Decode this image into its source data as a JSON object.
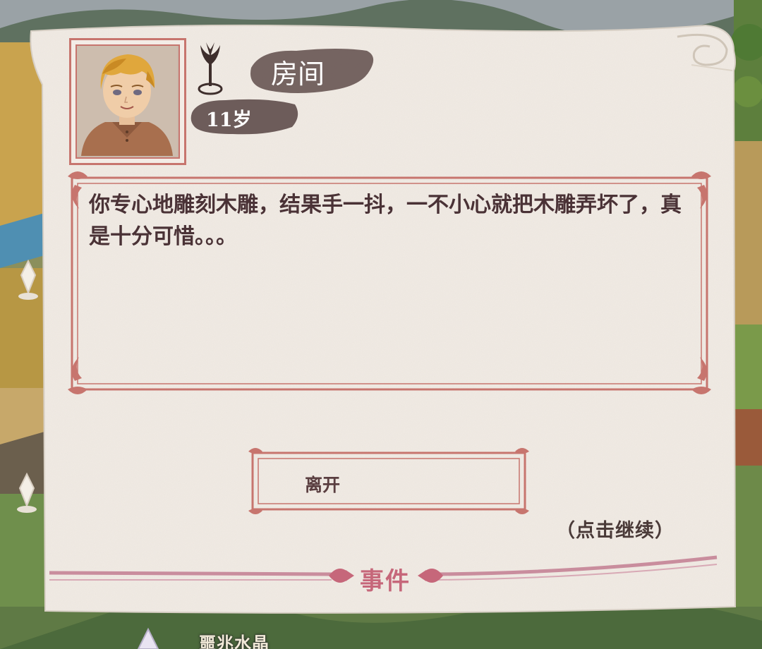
{
  "dialog": {
    "location": "房间",
    "age": "11岁",
    "message": "你专心地雕刻木雕，结果手一抖，一不小心就把木雕弄坏了，真是十分可惜。。。",
    "leave_option": "离开",
    "continue_hint": "（点击继续）",
    "footer_title": "事件"
  },
  "background": {
    "map_label": "噩兆水晶"
  },
  "colors": {
    "parchment": "#f1ebe4",
    "frame": "#c7756e",
    "ink_badge": "#5e4d4b",
    "text": "#4a3236",
    "event_pink": "#c6677a"
  }
}
